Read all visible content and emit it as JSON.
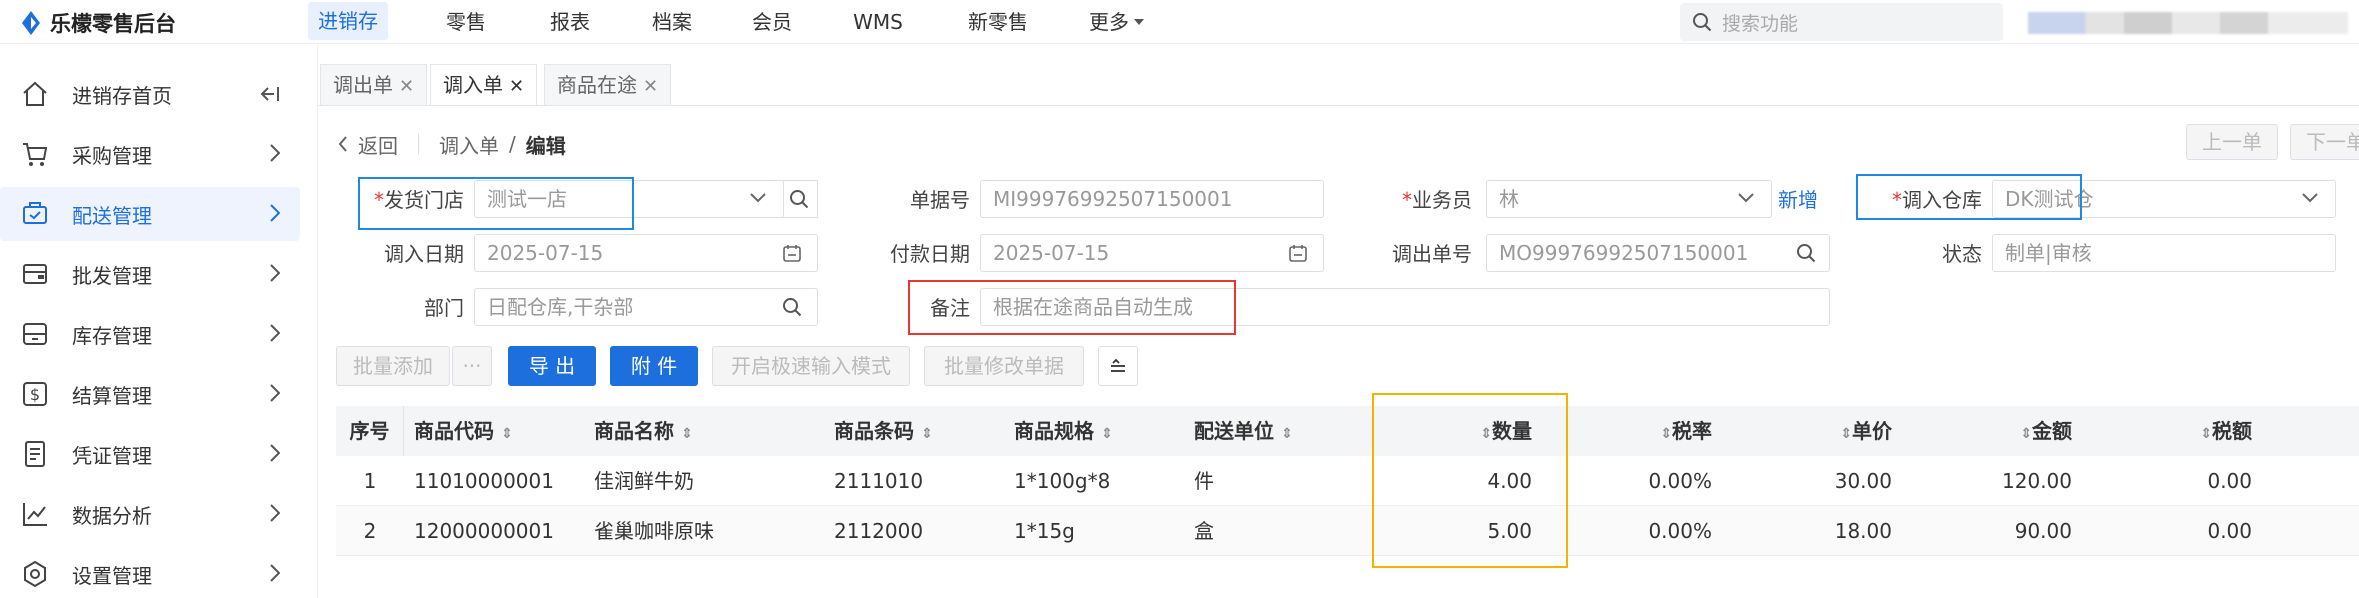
{
  "app": {
    "title": "乐檬零售后台"
  },
  "nav": {
    "items": [
      "进销存",
      "零售",
      "报表",
      "档案",
      "会员",
      "WMS",
      "新零售",
      "更多"
    ],
    "search_placeholder": "搜索功能"
  },
  "sidebar": {
    "items": [
      "进销存首页",
      "采购管理",
      "配送管理",
      "批发管理",
      "库存管理",
      "结算管理",
      "凭证管理",
      "数据分析",
      "设置管理"
    ]
  },
  "tabs": [
    {
      "label": "调出单"
    },
    {
      "label": "调入单"
    },
    {
      "label": "商品在途"
    }
  ],
  "breadcrumb": {
    "back": "返回",
    "parent": "调入单",
    "separator": "/",
    "current": "编辑"
  },
  "pager": {
    "prev": "上一单",
    "next": "下一单"
  },
  "form": {
    "send_store": {
      "label": "发货门店",
      "value": "测试一店"
    },
    "order_no": {
      "label": "单据号",
      "value": "MI99976992507150001"
    },
    "salesman": {
      "label": "业务员",
      "value": "林",
      "add": "新增"
    },
    "in_warehouse": {
      "label": "调入仓库",
      "value": "DK测试仓"
    },
    "in_date": {
      "label": "调入日期",
      "value": "2025-07-15"
    },
    "pay_date": {
      "label": "付款日期",
      "value": "2025-07-15"
    },
    "out_order_no": {
      "label": "调出单号",
      "value": "MO99976992507150001"
    },
    "status": {
      "label": "状态",
      "value": "制单|审核"
    },
    "dept": {
      "label": "部门",
      "value": "日配仓库,干杂部"
    },
    "remark": {
      "label": "备注",
      "value": "根据在途商品自动生成"
    }
  },
  "toolbar": {
    "batch_add": "批量添加",
    "more": "···",
    "export": "导 出",
    "attach": "附 件",
    "fast_input": "开启极速输入模式",
    "batch_edit": "批量修改单据"
  },
  "table": {
    "columns": [
      "序号",
      "商品代码",
      "商品名称",
      "商品条码",
      "商品规格",
      "配送单位",
      "数量",
      "税率",
      "单价",
      "金额",
      "税额"
    ],
    "rows": [
      [
        "1",
        "11010000001",
        "佳润鲜牛奶",
        "2111010",
        "1*100g*8",
        "件",
        "4.00",
        "0.00%",
        "30.00",
        "120.00",
        "0.00"
      ],
      [
        "2",
        "12000000001",
        "雀巢咖啡原味",
        "2112000",
        "1*15g",
        "盒",
        "5.00",
        "0.00%",
        "18.00",
        "90.00",
        "0.00"
      ]
    ]
  },
  "colors": {
    "accent": "#1e6fde",
    "highlight_blue": "#1e88e5",
    "highlight_red": "#e53935",
    "highlight_orange": "#f5b300"
  }
}
